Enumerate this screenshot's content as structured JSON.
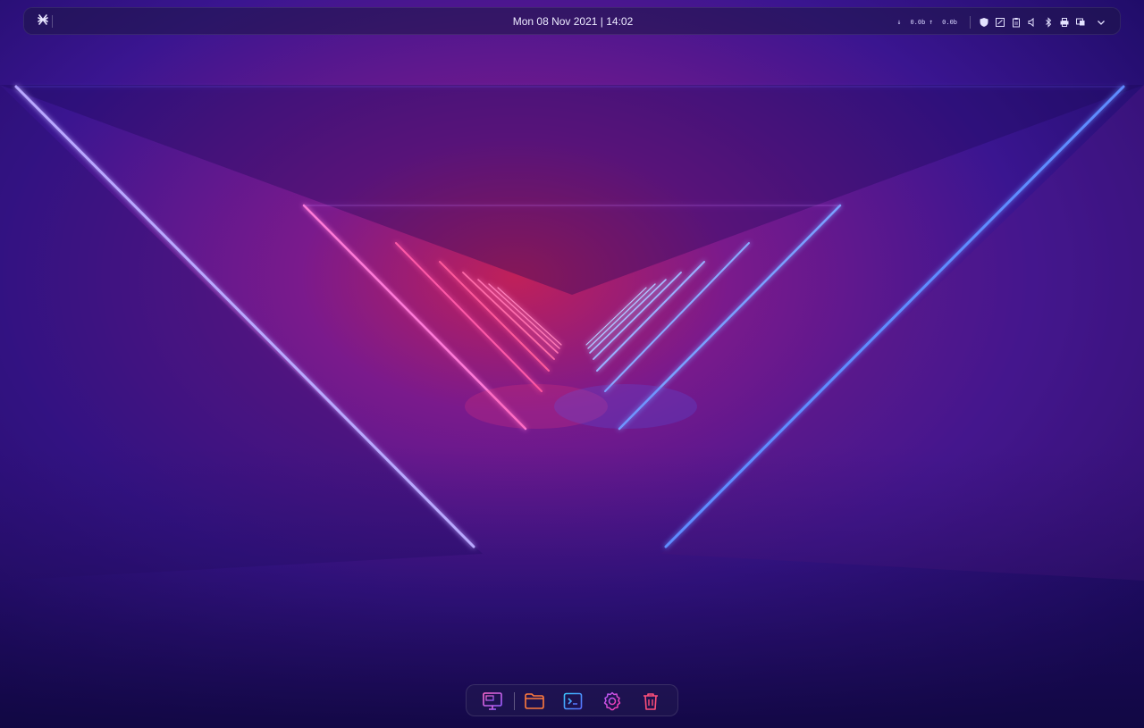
{
  "top_panel": {
    "launcher_icon": "deepin-launcher-icon",
    "clock_text": "Mon 08 Nov 2021 | 14:02",
    "network": {
      "download_arrow": "↓",
      "download": "0.0b",
      "upload_arrow": "↑",
      "upload": "0.0b"
    },
    "tray_icons": [
      "shield-icon",
      "screenshot-icon",
      "clipboard-icon",
      "volume-icon",
      "bluetooth-icon",
      "printer-icon",
      "display-icon",
      "chevron-down-icon"
    ]
  },
  "dock": {
    "items": [
      {
        "name": "multitasking-view",
        "icon": "desktop-monitor-icon",
        "color": "#b86cff"
      },
      {
        "name": "file-manager",
        "icon": "folder-icon",
        "color": "#ff7a3d"
      },
      {
        "name": "terminal",
        "icon": "terminal-icon",
        "color": "#4aa3ff"
      },
      {
        "name": "settings",
        "icon": "gear-icon",
        "color": "#e040c8"
      },
      {
        "name": "trash",
        "icon": "trash-icon",
        "color": "#ff4f7a"
      }
    ]
  },
  "colors": {
    "wallpaper_base": "#1a0a5c",
    "neon_pink": "#ff3a9a",
    "neon_blue": "#3a6bff"
  }
}
